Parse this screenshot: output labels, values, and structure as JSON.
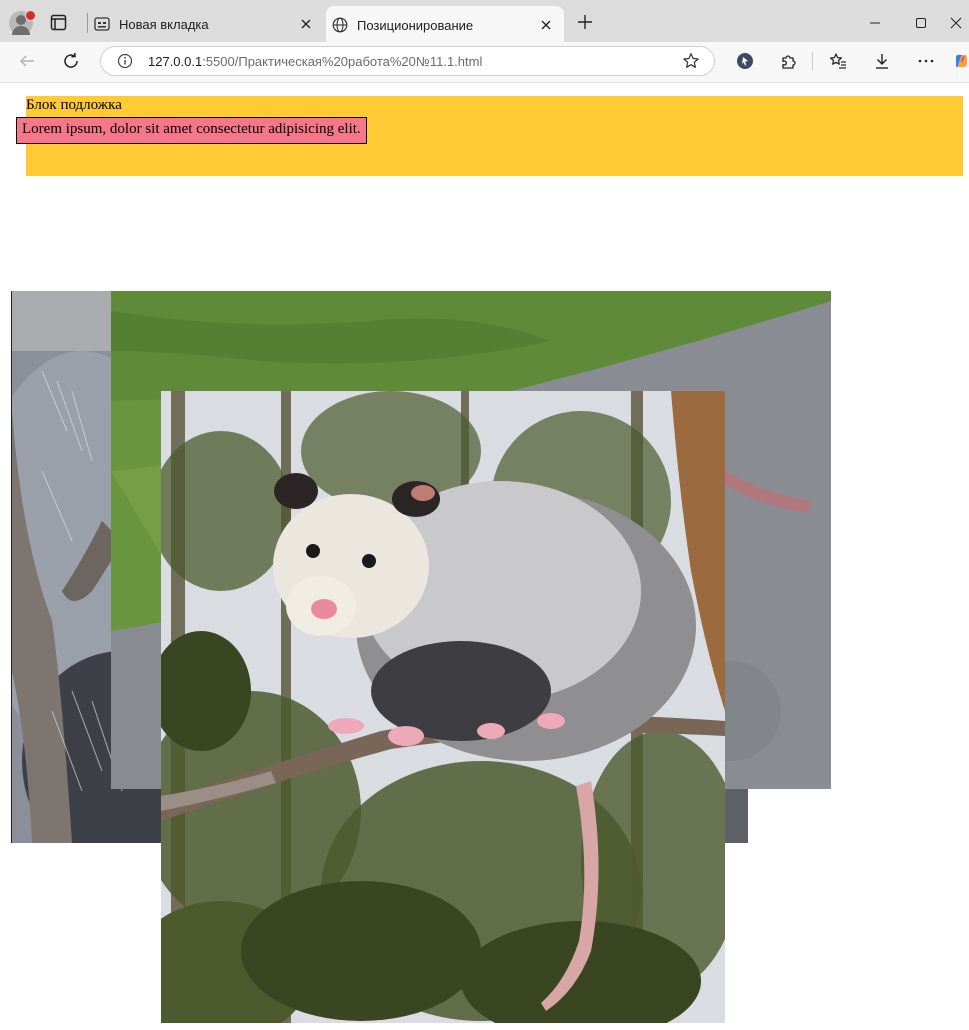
{
  "browser": {
    "tabs": [
      {
        "title": "Новая вкладка",
        "icon": "new-tab-page-icon",
        "active": false
      },
      {
        "title": "Позиционирование",
        "icon": "globe-icon",
        "active": true
      }
    ],
    "address_bar": {
      "host": "127.0.0.1",
      "path": ":5500/Практическая%20работа%20№11.1.html"
    },
    "toolbar_icons": [
      "back-icon",
      "reload-icon",
      "info-icon",
      "star-icon",
      "extension-shield-icon",
      "puzzle-icon",
      "favorites-icon",
      "download-icon",
      "more-icon",
      "copilot-icon"
    ],
    "window_controls": [
      "minimize-icon",
      "maximize-icon",
      "close-icon"
    ]
  },
  "page": {
    "underlay_label": "Блок подложка",
    "lorem_text": "Lorem ipsum, dolor sit amet consectetur adipisicing elit.",
    "underlay_color": "#ffca33",
    "lorem_bg_color": "#f6778a",
    "images": [
      {
        "name": "opossum-closeup-image",
        "subject": "opossum fur close-up"
      },
      {
        "name": "opossum-on-path-image",
        "subject": "opossum on grass and asphalt path"
      },
      {
        "name": "opossum-on-branch-image",
        "subject": "opossum sitting on a tree branch"
      }
    ]
  }
}
